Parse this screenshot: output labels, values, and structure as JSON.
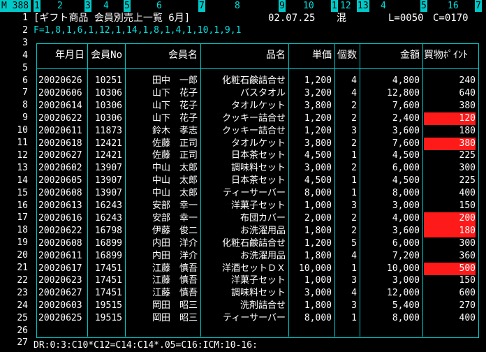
{
  "ruler": {
    "mode": "M 388",
    "cols": [
      "1",
      "2",
      "3",
      "4",
      "5",
      "6",
      "7",
      "8",
      "9",
      "10",
      "1",
      "12",
      "13",
      "4",
      "5",
      "16",
      "7"
    ]
  },
  "header": {
    "title": "[ギフト商品 会員別売上一覧 6月]",
    "date": "02.07.25",
    "status": "混",
    "line_info": "L=0050",
    "col_info": "C=0170",
    "format": "F=1,8,1,6,1,12,1,14,1,8,1,4,1,10,1,9,1"
  },
  "line_numbers": [
    "1",
    "2",
    "3",
    "4",
    "5",
    "6",
    "7",
    "8",
    "9",
    "10",
    "11",
    "12",
    "13",
    "14",
    "15",
    "16",
    "17",
    "18",
    "19",
    "20",
    "21",
    "22",
    "23",
    "24",
    "25",
    "26",
    "27"
  ],
  "table": {
    "headers": [
      "年月日",
      "会員No",
      "会員名",
      "品名",
      "単価",
      "個数",
      "金額",
      "買物ﾎﾟｲﾝﾄ"
    ],
    "rows": [
      {
        "date": "20020626",
        "no": "10251",
        "name": "田中　一郎",
        "item": "化粧石鹸詰合せ",
        "price": "1,200",
        "qty": "4",
        "amount": "4,800",
        "points": "240",
        "hl": false
      },
      {
        "date": "20020606",
        "no": "10306",
        "name": "山下　花子",
        "item": "バスタオル",
        "price": "3,200",
        "qty": "4",
        "amount": "12,800",
        "points": "640",
        "hl": false
      },
      {
        "date": "20020614",
        "no": "10306",
        "name": "山下　花子",
        "item": "タオルケット",
        "price": "3,800",
        "qty": "2",
        "amount": "7,600",
        "points": "380",
        "hl": false
      },
      {
        "date": "20020622",
        "no": "10306",
        "name": "山下　花子",
        "item": "クッキー詰合せ",
        "price": "1,200",
        "qty": "2",
        "amount": "2,400",
        "points": "120",
        "hl": true
      },
      {
        "date": "20020611",
        "no": "11873",
        "name": "鈴木　孝志",
        "item": "クッキー詰合せ",
        "price": "1,200",
        "qty": "3",
        "amount": "3,600",
        "points": "180",
        "hl": false
      },
      {
        "date": "20020618",
        "no": "12421",
        "name": "佐藤　正司",
        "item": "タオルケット",
        "price": "3,800",
        "qty": "2",
        "amount": "7,600",
        "points": "380",
        "hl": true
      },
      {
        "date": "20020627",
        "no": "12421",
        "name": "佐藤　正司",
        "item": "日本茶セット",
        "price": "4,500",
        "qty": "1",
        "amount": "4,500",
        "points": "225",
        "hl": false
      },
      {
        "date": "20020602",
        "no": "13907",
        "name": "中山　太郎",
        "item": "調味料セット",
        "price": "3,000",
        "qty": "2",
        "amount": "6,000",
        "points": "300",
        "hl": false
      },
      {
        "date": "20020605",
        "no": "13907",
        "name": "中山　太郎",
        "item": "日本茶セット",
        "price": "4,500",
        "qty": "1",
        "amount": "4,500",
        "points": "225",
        "hl": false
      },
      {
        "date": "20020608",
        "no": "13907",
        "name": "中山　太郎",
        "item": "ティーサーバー",
        "price": "8,000",
        "qty": "1",
        "amount": "8,000",
        "points": "400",
        "hl": false
      },
      {
        "date": "20020613",
        "no": "16243",
        "name": "安部　幸一",
        "item": "洋菓子セット",
        "price": "1,000",
        "qty": "3",
        "amount": "3,000",
        "points": "150",
        "hl": false
      },
      {
        "date": "20020616",
        "no": "16243",
        "name": "安部　幸一",
        "item": "布団カバー",
        "price": "2,000",
        "qty": "2",
        "amount": "4,000",
        "points": "200",
        "hl": true
      },
      {
        "date": "20020622",
        "no": "16798",
        "name": "伊藤　俊二",
        "item": "お洗濯用品",
        "price": "1,800",
        "qty": "2",
        "amount": "3,600",
        "points": "180",
        "hl": true
      },
      {
        "date": "20020608",
        "no": "16899",
        "name": "内田　洋介",
        "item": "化粧石鹸詰合せ",
        "price": "1,200",
        "qty": "5",
        "amount": "6,000",
        "points": "300",
        "hl": false
      },
      {
        "date": "20020611",
        "no": "16899",
        "name": "内田　洋介",
        "item": "お洗濯用品",
        "price": "1,800",
        "qty": "4",
        "amount": "7,200",
        "points": "360",
        "hl": false
      },
      {
        "date": "20020617",
        "no": "17451",
        "name": "江藤　慎吾",
        "item": "洋酒セットＤＸ",
        "price": "10,000",
        "qty": "1",
        "amount": "10,000",
        "points": "500",
        "hl": true
      },
      {
        "date": "20020623",
        "no": "17451",
        "name": "江藤　慎吾",
        "item": "洋菓子セット",
        "price": "1,000",
        "qty": "3",
        "amount": "3,000",
        "points": "150",
        "hl": false
      },
      {
        "date": "20020627",
        "no": "17451",
        "name": "江藤　慎吾",
        "item": "調味料セット",
        "price": "3,000",
        "qty": "4",
        "amount": "12,000",
        "points": "600",
        "hl": false
      },
      {
        "date": "20020603",
        "no": "19515",
        "name": "岡田　昭三",
        "item": "洗剤詰合せ",
        "price": "1,800",
        "qty": "3",
        "amount": "5,400",
        "points": "270",
        "hl": false
      },
      {
        "date": "20020625",
        "no": "19515",
        "name": "岡田　昭三",
        "item": "ティーサーバー",
        "price": "8,000",
        "qty": "1",
        "amount": "8,000",
        "points": "400",
        "hl": false
      }
    ]
  },
  "command_line": "DR:0:3:C10*C12=C14:C14*.05=C16:ICM:10-16:",
  "colors": {
    "accent": "#00c8c8",
    "highlight": "#ff1a1a",
    "text": "#ffffff",
    "background": "#000000"
  }
}
